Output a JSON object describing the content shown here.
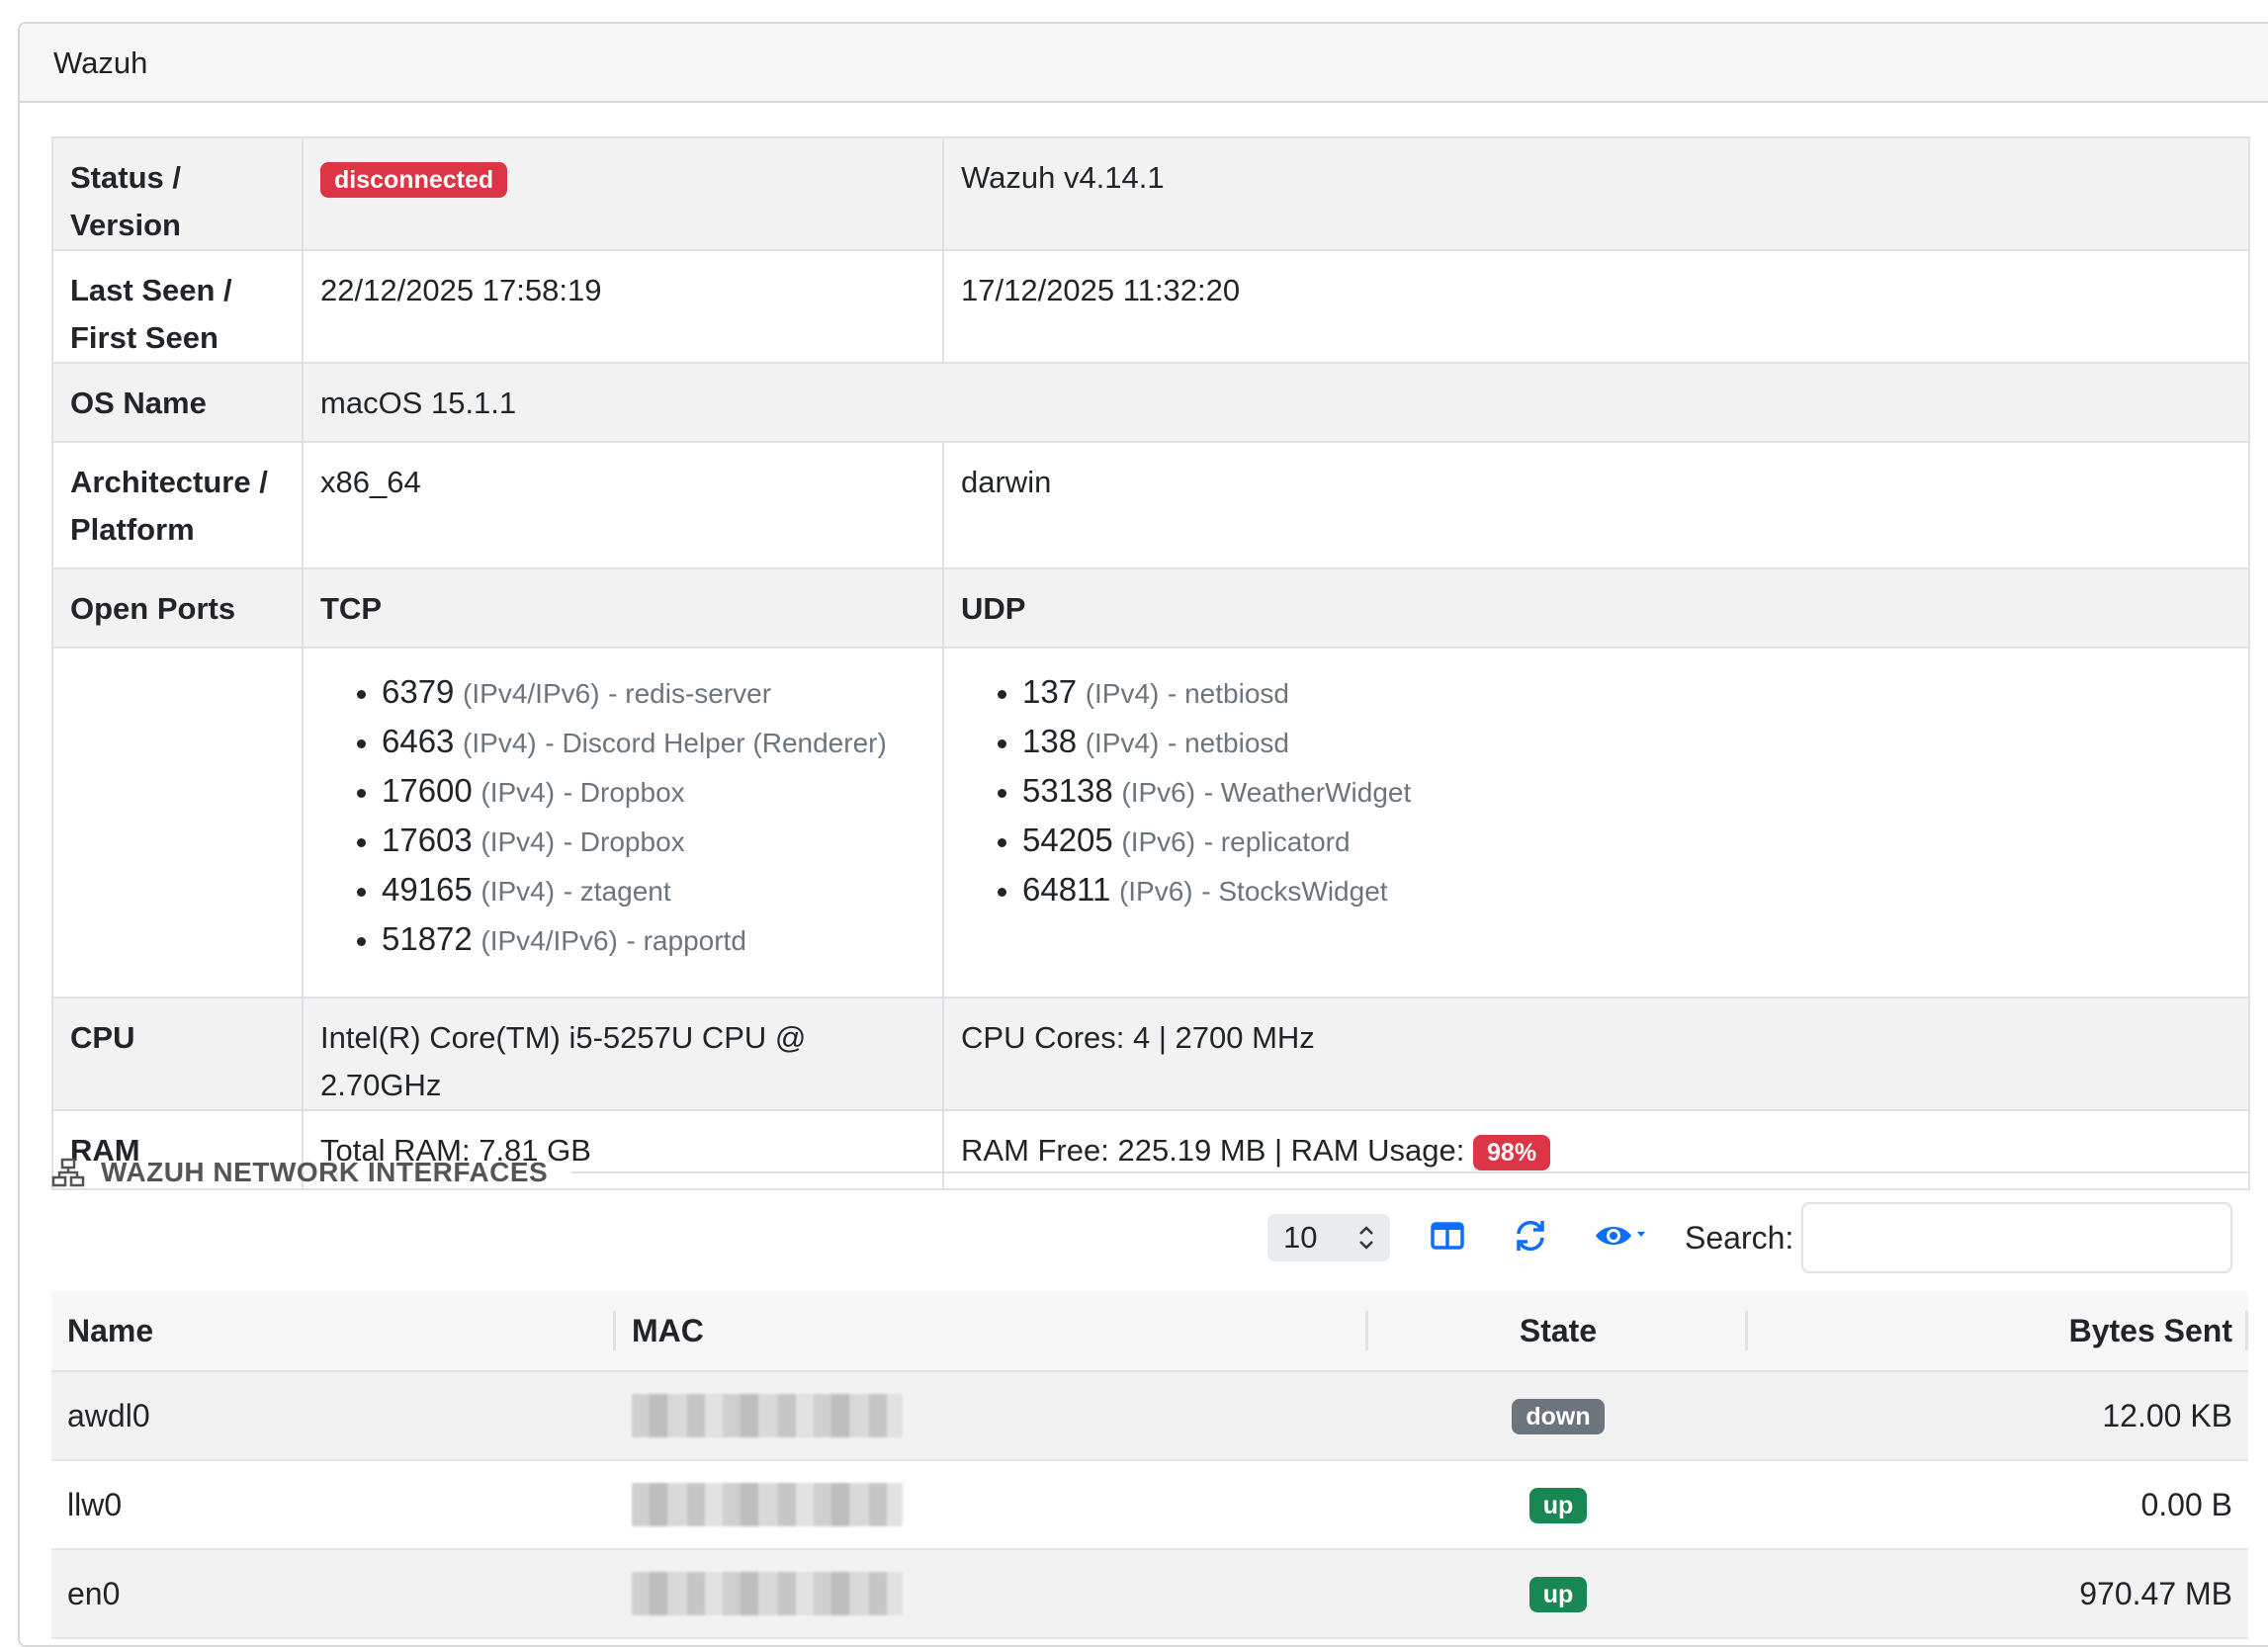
{
  "card": {
    "title": "Wazuh"
  },
  "info": {
    "status_label": "Status / Version",
    "status_badge": "disconnected",
    "version": "Wazuh v4.14.1",
    "seen_label": "Last Seen / First Seen",
    "last_seen": "22/12/2025 17:58:19",
    "first_seen": "17/12/2025 11:32:20",
    "os_label": "OS Name",
    "os_name": "macOS 15.1.1",
    "arch_label_1": "Architecture /",
    "arch_label_2": "Platform",
    "architecture": "x86_64",
    "platform": "darwin",
    "ports_label": "Open Ports",
    "tcp_label": "TCP",
    "udp_label": "UDP",
    "tcp_ports": [
      {
        "port": "6379",
        "proto": "(IPv4/IPv6)",
        "process": "- redis-server"
      },
      {
        "port": "6463",
        "proto": "(IPv4)",
        "process": "- Discord Helper (Renderer)"
      },
      {
        "port": "17600",
        "proto": "(IPv4)",
        "process": "- Dropbox"
      },
      {
        "port": "17603",
        "proto": "(IPv4)",
        "process": "- Dropbox"
      },
      {
        "port": "49165",
        "proto": "(IPv4)",
        "process": "- ztagent"
      },
      {
        "port": "51872",
        "proto": "(IPv4/IPv6)",
        "process": "- rapportd"
      }
    ],
    "udp_ports": [
      {
        "port": "137",
        "proto": "(IPv4)",
        "process": "- netbiosd"
      },
      {
        "port": "138",
        "proto": "(IPv4)",
        "process": "- netbiosd"
      },
      {
        "port": "53138",
        "proto": "(IPv6)",
        "process": "- WeatherWidget"
      },
      {
        "port": "54205",
        "proto": "(IPv6)",
        "process": "- replicatord"
      },
      {
        "port": "64811",
        "proto": "(IPv6)",
        "process": "- StocksWidget"
      }
    ],
    "cpu_label": "CPU",
    "cpu_model": "Intel(R) Core(TM) i5-5257U CPU @ 2.70GHz",
    "cpu_cores": "CPU Cores: 4 | 2700 MHz",
    "ram_label": "RAM",
    "ram_total": "Total RAM: 7.81 GB",
    "ram_free": "RAM Free: 225.19 MB | RAM Usage:",
    "ram_usage_badge": "98%"
  },
  "network": {
    "section_title": "WAZUH NETWORK INTERFACES",
    "page_length": "10",
    "search_label": "Search:",
    "search_value": "",
    "columns": [
      "Name",
      "MAC",
      "State",
      "Bytes Sent"
    ],
    "rows": [
      {
        "name": "awdl0",
        "state": "down",
        "bytes_sent": "12.00 KB"
      },
      {
        "name": "llw0",
        "state": "up",
        "bytes_sent": "0.00 B"
      },
      {
        "name": "en0",
        "state": "up",
        "bytes_sent": "970.47 MB"
      }
    ]
  },
  "colors": {
    "danger": "#dc3545",
    "success": "#198754",
    "secondary": "#6c757d",
    "primary_icon": "#0d6efd"
  },
  "icons": {
    "section": "network-icon",
    "toolbar": [
      "column-visibility-icon",
      "refresh-icon",
      "eye-icon"
    ]
  }
}
